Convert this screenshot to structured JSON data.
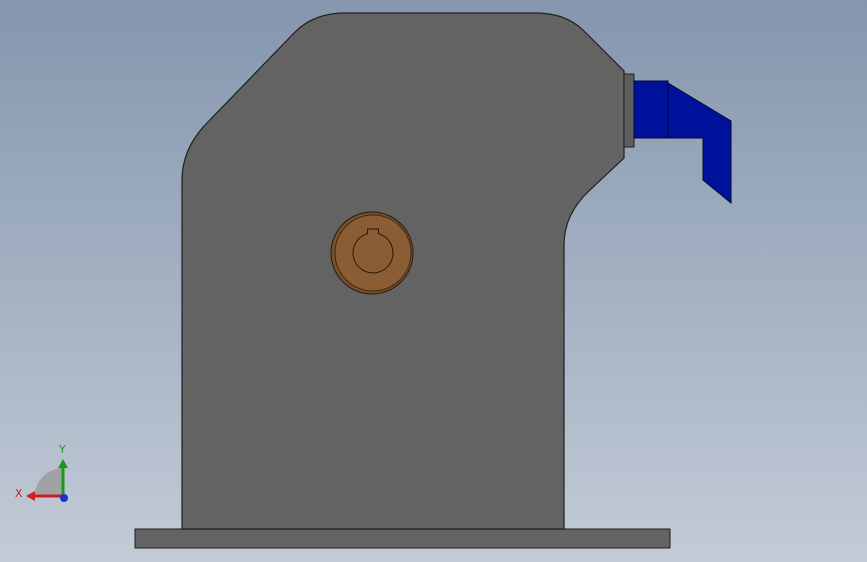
{
  "viewport": {
    "background_top": "#8596ad",
    "background_bottom": "#c3cbd7"
  },
  "model": {
    "housing_color": "#636363",
    "base_plate_color": "#636363",
    "shaft_color": "#8a5d34",
    "bracket_color": "#00129c"
  },
  "triad": {
    "y_label": "Y",
    "x_label": "X",
    "y_axis_color": "#1a9a1a",
    "x_axis_color": "#c8201e",
    "z_axis_color": "#1a2fd0"
  }
}
